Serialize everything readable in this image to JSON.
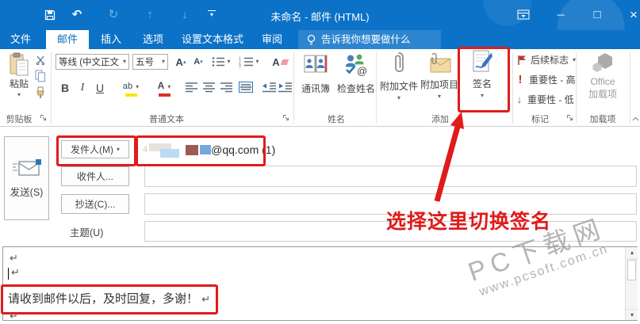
{
  "colors": {
    "titlebar_blue": "#0b72c7",
    "active_tab_text": "#0a6ebd",
    "annotation_red": "#e01b1b",
    "high_importance_red": "#c0392b",
    "low_importance_blue": "#2e75b6",
    "watermark_gray": "#9f9f9f"
  },
  "glyphs": {
    "undo": "↶",
    "redo": "↻",
    "up_arrow": "↑",
    "down_arrow": "↓",
    "more_caret": "▾",
    "caret": "▾",
    "caret_up": "▴",
    "minimize": "─",
    "maximize": "□",
    "close": "×",
    "letter_a": "A",
    "letters_ab": "ab",
    "scroll_up": "▴",
    "scroll_down": "▾"
  },
  "titlebar": {
    "title": "未命名 - 邮件 (HTML)"
  },
  "tabs": {
    "file": "文件",
    "message": "邮件",
    "insert": "插入",
    "options": "选项",
    "format_text": "设置文本格式",
    "review": "审阅",
    "tellme": "告诉我你想要做什么"
  },
  "ribbon": {
    "paste": "粘贴",
    "clipboard_group": "剪贴板",
    "font_name": "等线 (中文正文",
    "font_size": "五号",
    "bold": "B",
    "italic": "I",
    "underline": "U",
    "basic_text_group": "普通文本",
    "address_book": "通讯簿",
    "check_names": "检查姓名",
    "names_group": "姓名",
    "attach_file": "附加文件",
    "attach_item": "附加项目",
    "signature": "签名",
    "include_group": "添加",
    "follow_up": "后续标志",
    "high_importance": "重要性 - 高",
    "low_importance": "重要性 - 低",
    "tags_group": "标记",
    "office_addins_line1": "Office",
    "office_addins_line2": "加载项",
    "addins_group": "加载项"
  },
  "form": {
    "send": "发送(S)",
    "from_button": "发件人(M)",
    "from_value_prefix": "4",
    "from_value": "@qq.com (1)",
    "to_button": "收件人...",
    "cc_button": "抄送(C)...",
    "subject_label": "主题(U)"
  },
  "annotation": {
    "text": "选择这里切换签名"
  },
  "body": {
    "paragraph_mark": "↵",
    "text": "请收到邮件以后，及时回复，多谢！"
  },
  "watermark": {
    "line1": "PC下载网",
    "line2": "www.pcsoft.com.cn"
  }
}
